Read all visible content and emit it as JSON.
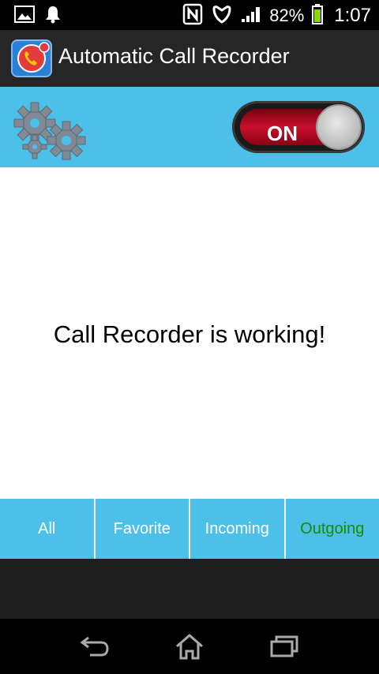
{
  "status_bar": {
    "battery_percent": "82%",
    "time": "1:07",
    "icons": [
      "gallery-icon",
      "notification-bell-icon",
      "nfc-icon",
      "sync-icon",
      "signal-icon",
      "battery-icon"
    ]
  },
  "action_bar": {
    "title": "Automatic Call Recorder",
    "app_icon": "call-recorder-app-icon"
  },
  "controls": {
    "settings_icon": "gears-icon",
    "toggle_label": "ON",
    "toggle_state": "on"
  },
  "main": {
    "message": "Call Recorder is working!"
  },
  "tabs": [
    {
      "label": "All"
    },
    {
      "label": "Favorite"
    },
    {
      "label": "Incoming"
    },
    {
      "label": "Outgoing"
    }
  ],
  "colors": {
    "accent_blue": "#4cc0e8",
    "toggle_red": "#c8102e",
    "active_tab_green": "#1a8a00"
  },
  "navigation": {
    "icons": [
      "back-icon",
      "home-icon",
      "recent-apps-icon"
    ]
  }
}
